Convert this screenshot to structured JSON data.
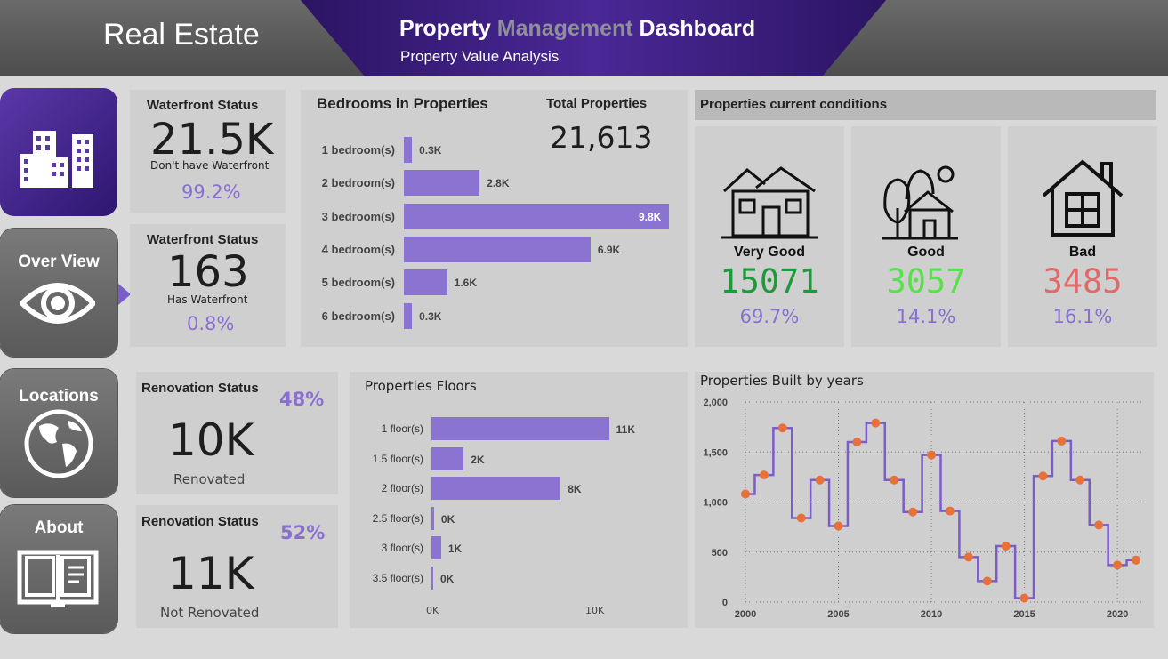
{
  "header": {
    "app_title": "Real Estate",
    "dashboard_title_part1": "Property",
    "dashboard_title_part2": "Management",
    "dashboard_title_part3": "Dashboard",
    "subtitle": "Property Value Analysis",
    "band_color": "#3d1f7e"
  },
  "nav": {
    "items": [
      {
        "label": "",
        "icon": "buildings-icon",
        "active": false
      },
      {
        "label": "Over View",
        "icon": "eye-icon",
        "active": true
      },
      {
        "label": "Locations",
        "icon": "globe-icon",
        "active": false
      },
      {
        "label": "About",
        "icon": "book-icon",
        "active": false
      }
    ]
  },
  "waterfront": [
    {
      "title": "Waterfront Status",
      "value": "21.5K",
      "caption": "Don't have Waterfront",
      "percent": "99.2%"
    },
    {
      "title": "Waterfront Status",
      "value": "163",
      "caption": "Has Waterfront",
      "percent": "0.8%"
    }
  ],
  "bedrooms": {
    "title": "Bedrooms in Properties",
    "total_label": "Total Properties",
    "total_value": "21,613"
  },
  "conditions": {
    "title": "Properties current conditions",
    "items": [
      {
        "name": "Very Good",
        "value": "15071",
        "percent": "69.7%",
        "color": "#1f9a3a",
        "icon": "house-icon"
      },
      {
        "name": "Good",
        "value": "3057",
        "percent": "14.1%",
        "color": "#59e04c",
        "icon": "house-trees-icon"
      },
      {
        "name": "Bad",
        "value": "3485",
        "percent": "16.1%",
        "color": "#e06a6a",
        "icon": "home-icon"
      }
    ]
  },
  "renovation": [
    {
      "title": "Renovation Status",
      "percent": "48%",
      "value": "10K",
      "caption": "Renovated"
    },
    {
      "title": "Renovation Status",
      "percent": "52%",
      "value": "11K",
      "caption": "Not Renovated"
    }
  ],
  "floors": {
    "title": "Properties Floors",
    "axis_start": "0K",
    "axis_end": "10K"
  },
  "built": {
    "title": "Properties Built by years"
  },
  "chart_data": [
    {
      "type": "bar",
      "title": "Bedrooms in Properties",
      "categories": [
        "1 bedroom(s)",
        "2 bedroom(s)",
        "3 bedroom(s)",
        "4 bedroom(s)",
        "5 bedroom(s)",
        "6 bedroom(s)"
      ],
      "values": [
        0.3,
        2.8,
        9.8,
        6.9,
        1.6,
        0.3
      ],
      "value_labels": [
        "0.3K",
        "2.8K",
        "9.8K",
        "6.9K",
        "1.6K",
        "0.3K"
      ],
      "orientation": "horizontal",
      "xlim": [
        0,
        9.8
      ],
      "color": "#8b74d1"
    },
    {
      "type": "bar",
      "title": "Properties Floors",
      "categories": [
        "1 floor(s)",
        "1.5 floor(s)",
        "2 floor(s)",
        "2.5 floor(s)",
        "3 floor(s)",
        "3.5 floor(s)"
      ],
      "values": [
        11,
        2,
        8,
        0.16,
        0.6,
        0.01
      ],
      "value_labels": [
        "11K",
        "2K",
        "8K",
        "0K",
        "1K",
        "0K"
      ],
      "orientation": "horizontal",
      "xlim": [
        0,
        10
      ],
      "x_ticks": [
        "0K",
        "10K"
      ],
      "color": "#8b74d1"
    },
    {
      "type": "line",
      "title": "Properties Built by years",
      "step": true,
      "x": [
        2000,
        2001,
        2002,
        2003,
        2004,
        2005,
        2006,
        2007,
        2008,
        2009,
        2010,
        2011,
        2012,
        2013,
        2014,
        2015,
        2016,
        2017,
        2018,
        2019,
        2020,
        2021
      ],
      "y": [
        1080,
        1270,
        1740,
        840,
        1220,
        760,
        1600,
        1790,
        1220,
        900,
        1470,
        910,
        450,
        210,
        560,
        40,
        1260,
        1610,
        1220,
        770,
        370,
        420
      ],
      "xlim": [
        2000,
        2021
      ],
      "ylim": [
        0,
        2000
      ],
      "x_ticks": [
        2000,
        2005,
        2010,
        2015,
        2020
      ],
      "y_ticks": [
        0,
        500,
        1000,
        1500,
        2000
      ],
      "y_tick_labels": [
        "0",
        "500",
        "1,000",
        "1,500",
        "2,000"
      ],
      "grid": true,
      "line_color": "#7b5dc9",
      "marker_color": "#e8703a"
    }
  ]
}
